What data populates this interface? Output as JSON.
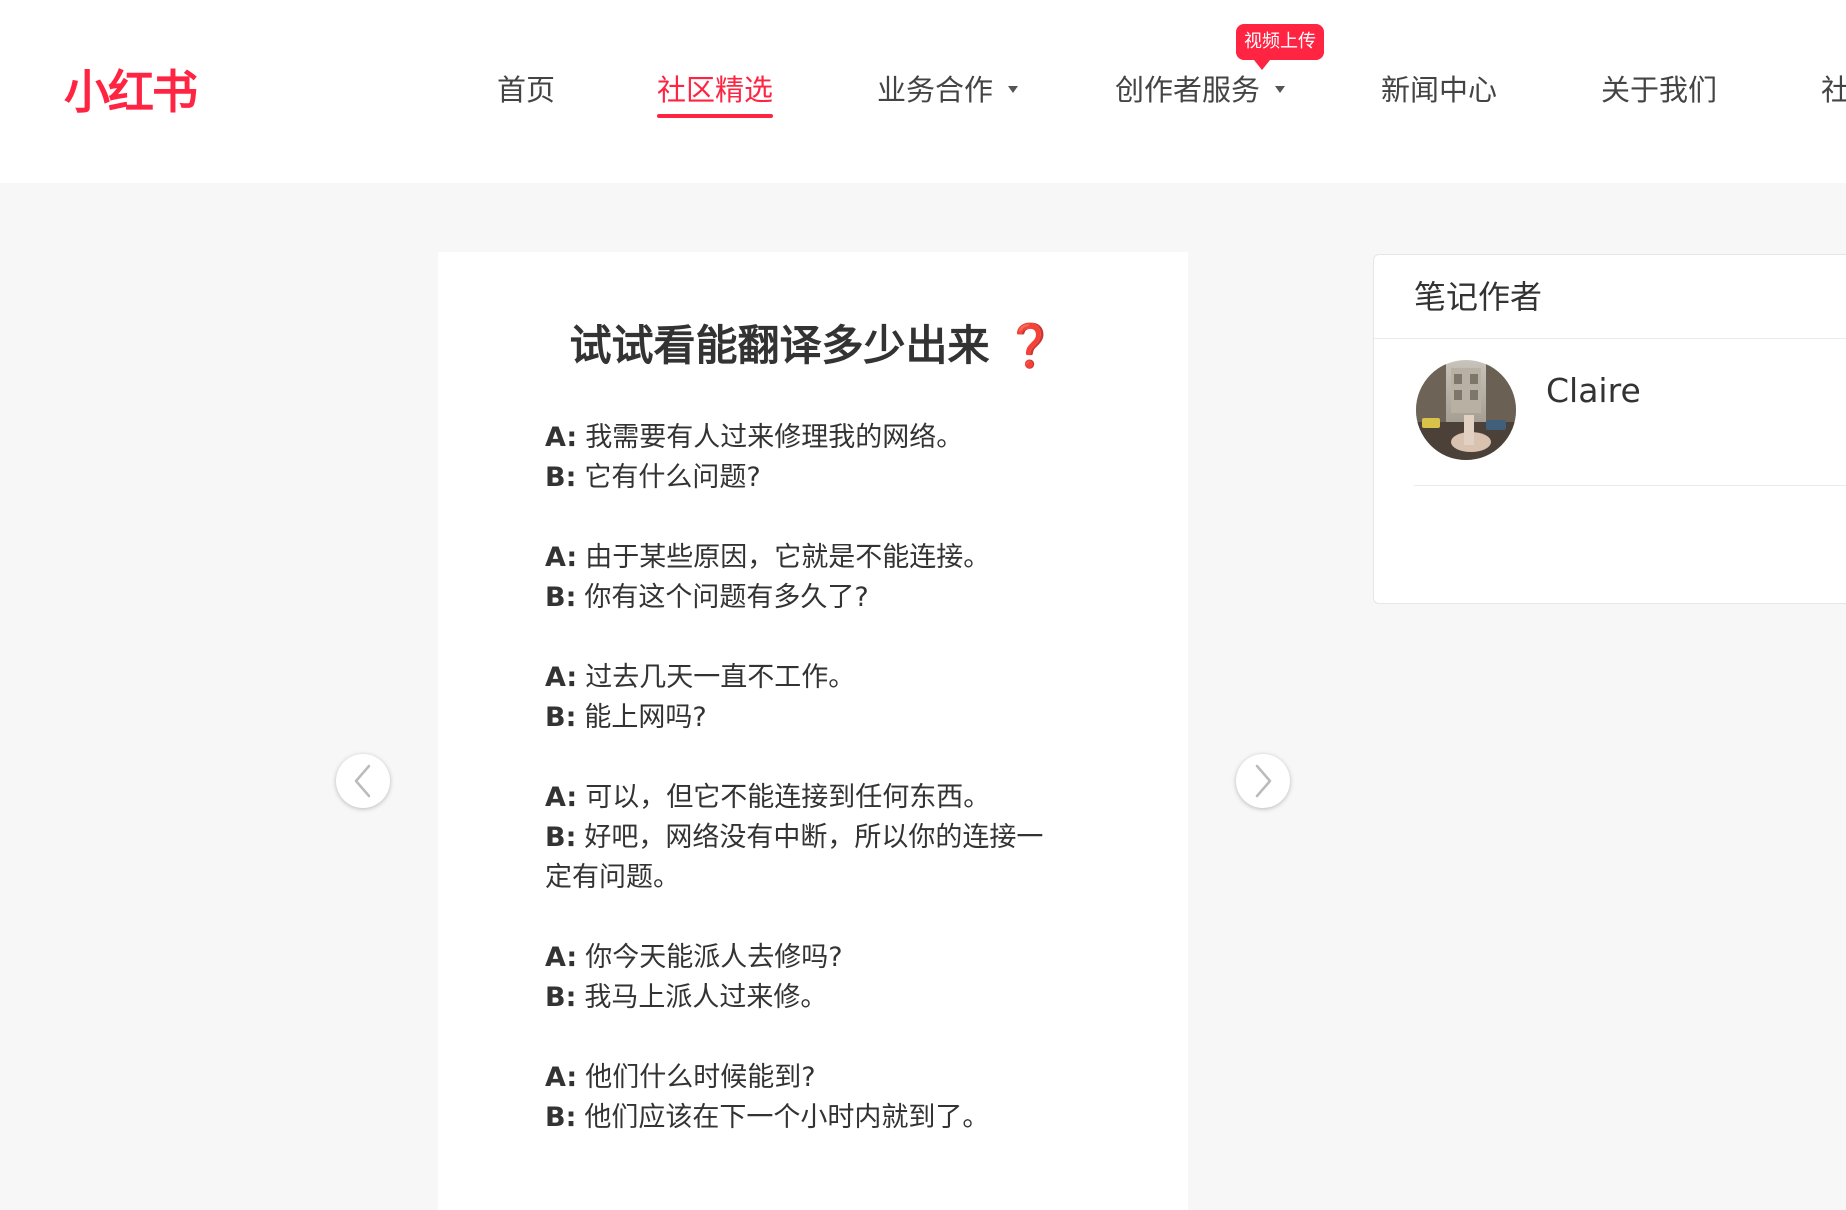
{
  "header": {
    "logo_text": "小红书",
    "nav": [
      {
        "label": "首页"
      },
      {
        "label": "社区精选"
      },
      {
        "label": "业务合作"
      },
      {
        "label": "创作者服务"
      },
      {
        "label": "新闻中心"
      },
      {
        "label": "关于我们"
      },
      {
        "label": "社"
      }
    ],
    "badge": "视频上传"
  },
  "colors": {
    "brand": "#ff2442",
    "question_mark": "#d32020"
  },
  "note": {
    "title": "试试看能翻译多少出来",
    "title_mark": "❓",
    "dialogues": [
      {
        "a": "我需要有人过来修理我的网络。",
        "b": "它有什么问题?"
      },
      {
        "a": "由于某些原因，它就是不能连接。",
        "b": "你有这个问题有多久了?"
      },
      {
        "a": "过去几天一直不工作。",
        "b": "能上网吗?"
      },
      {
        "a": "可以，但它不能连接到任何东西。",
        "b": "好吧，网络没有中断，所以你的连接一定有问题。"
      },
      {
        "a": "你今天能派人去修吗?",
        "b": "我马上派人过来修。"
      },
      {
        "a": "他们什么时候能到?",
        "b": "他们应该在下一个小时内就到了。"
      }
    ],
    "speaker_a": "A:",
    "speaker_b": "B:"
  },
  "author_panel": {
    "title": "笔记作者",
    "name": "Claire"
  },
  "icons": {
    "prev": "chevron-left-icon",
    "next": "chevron-right-icon",
    "dropdown": "caret-down-icon"
  }
}
